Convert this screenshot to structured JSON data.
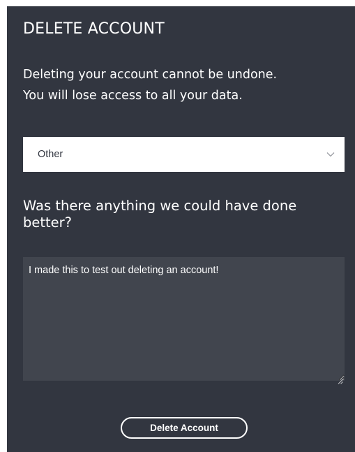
{
  "dialog": {
    "title": "DELETE ACCOUNT",
    "warning_line1": "Deleting your account cannot be undone.",
    "warning_line2": "You will lose access to all your data."
  },
  "reason_select": {
    "selected_value": "Other",
    "icon": "chevron-down-icon"
  },
  "feedback": {
    "question": "Was there anything we could have done better?",
    "value": "I made this to test out deleting an account!"
  },
  "actions": {
    "delete_label": "Delete Account"
  },
  "colors": {
    "panel_background": "#323640",
    "textarea_background": "#41454e",
    "text": "#ffffff"
  }
}
